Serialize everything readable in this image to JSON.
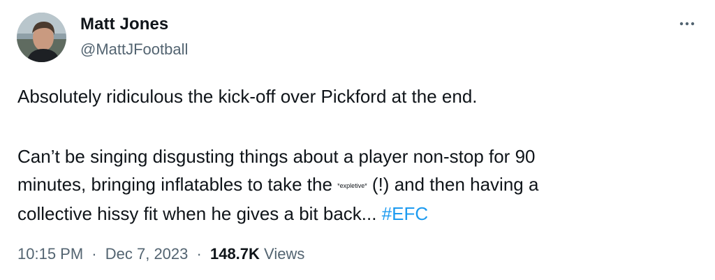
{
  "author": {
    "name": "Matt Jones",
    "handle": "@MattJFootball"
  },
  "more_icon": "more-horizontal-icon",
  "tweet": {
    "line1": "Absolutely ridiculous the kick-off over Pickford at the end.",
    "line2": "Can’t be singing disgusting things about a player non-stop for 90",
    "line3_pre": "minutes, bringing inflatables to take the ",
    "expletive": "*expletive*",
    "line3_post": " (!) and then having a",
    "line4_pre": "collective hissy fit when he gives a bit back... ",
    "hashtag": "#EFC"
  },
  "meta": {
    "time": "10:15 PM",
    "separator": "·",
    "date": "Dec 7, 2023",
    "views_count": "148.7K",
    "views_label": "Views"
  },
  "colors": {
    "text": "#0f1419",
    "secondary": "#536471",
    "link": "#1d9bf0"
  }
}
